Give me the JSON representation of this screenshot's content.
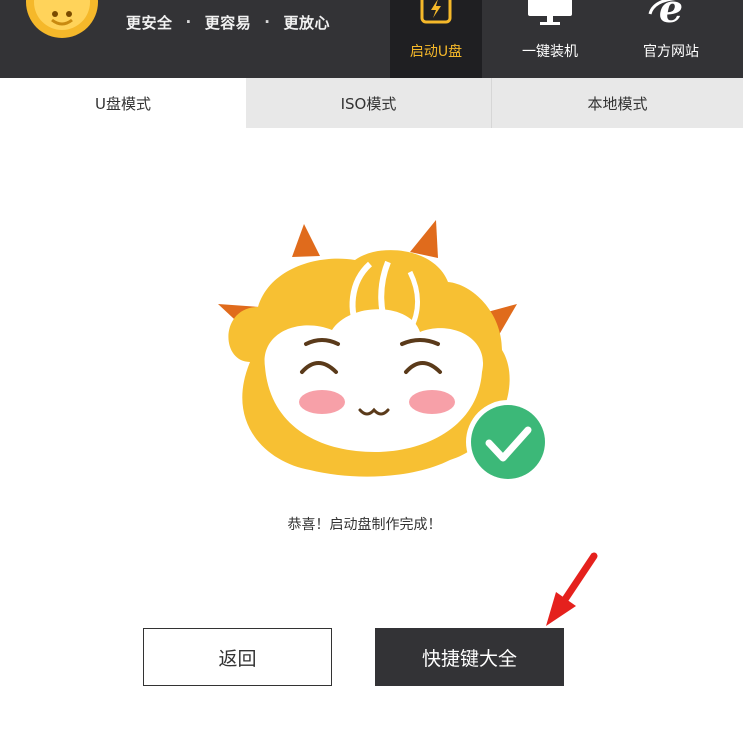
{
  "header": {
    "slogan": [
      "更安全",
      "更容易",
      "更放心"
    ],
    "separator": "·",
    "nav": [
      {
        "label": "启动U盘",
        "icon": "lightning-usb-icon",
        "active": true
      },
      {
        "label": "一键装机",
        "icon": "monitor-icon",
        "active": false
      },
      {
        "label": "官方网站",
        "icon": "ie-browser-icon",
        "active": false
      }
    ]
  },
  "tabs": [
    {
      "label": "U盘模式",
      "active": true
    },
    {
      "label": "ISO模式",
      "active": false
    },
    {
      "label": "本地模式",
      "active": false
    }
  ],
  "main": {
    "mascot_icon": "smiling-mascot-icon",
    "badge_icon": "check-circle-icon",
    "success_message": "恭喜！启动盘制作完成！",
    "back_button": "返回",
    "shortcuts_button": "快捷键大全",
    "arrow_icon": "red-arrow-icon"
  },
  "colors": {
    "header_bg": "#333336",
    "accent": "#f5b82a",
    "success_green": "#3cb878",
    "arrow_red": "#e5211d"
  }
}
